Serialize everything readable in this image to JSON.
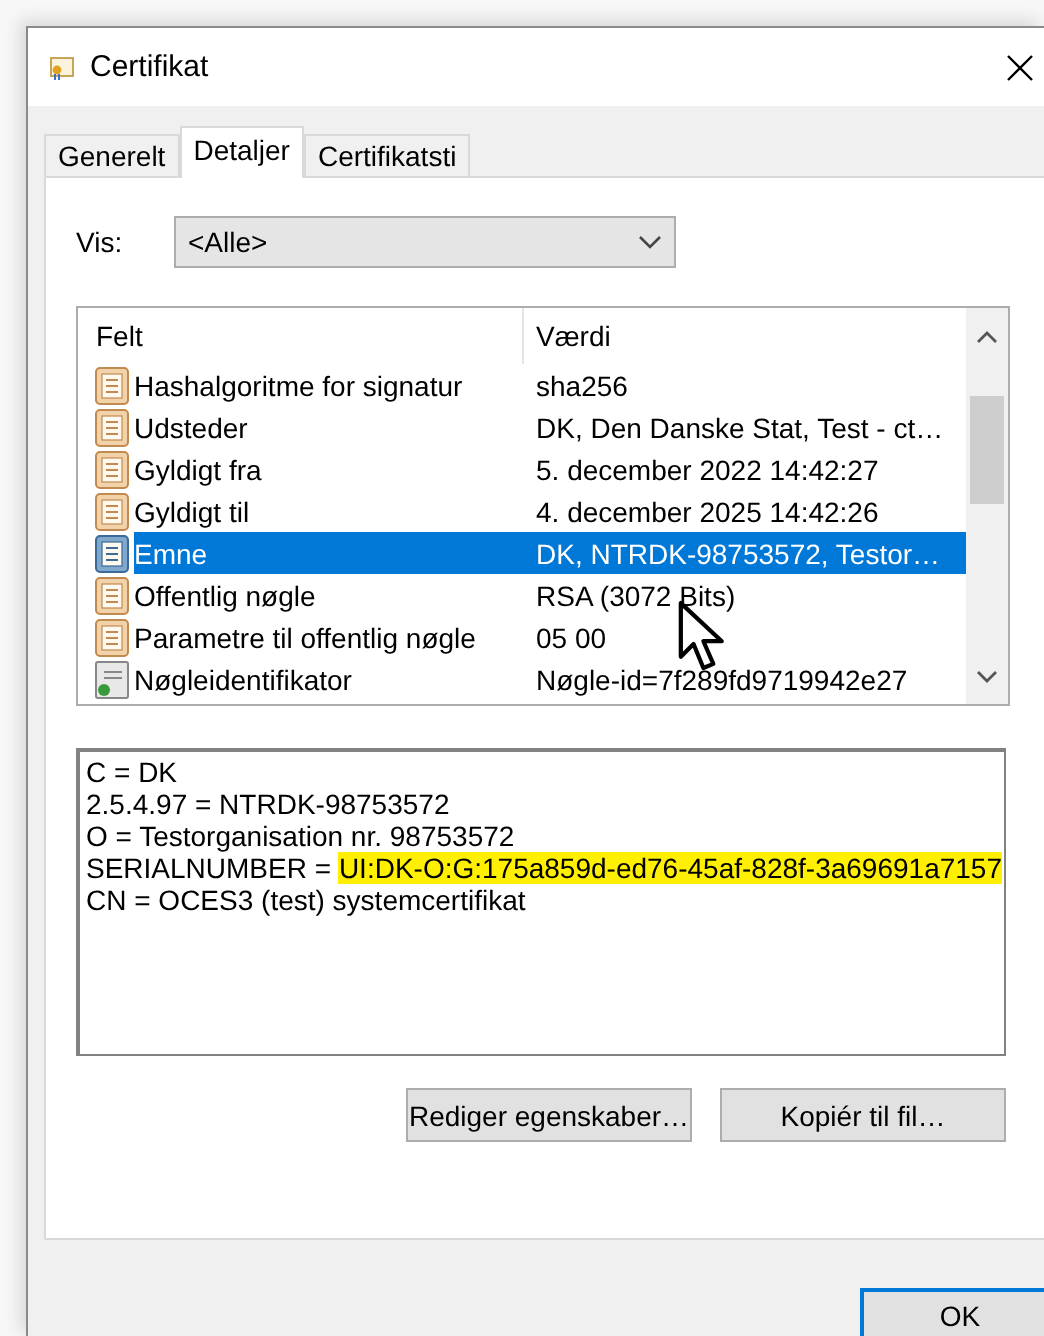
{
  "window": {
    "title": "Certifikat"
  },
  "tabs": [
    {
      "label": "Generelt",
      "selected": false
    },
    {
      "label": "Detaljer",
      "selected": true
    },
    {
      "label": "Certifikatsti",
      "selected": false
    }
  ],
  "show": {
    "label": "Vis:",
    "value": "<Alle>"
  },
  "fields_list": {
    "columns": [
      "Felt",
      "Værdi"
    ],
    "rows": [
      {
        "kind": "field",
        "field": "Hashalgoritme for signatur",
        "value": "sha256",
        "selected": false
      },
      {
        "kind": "field",
        "field": "Udsteder",
        "value": "DK, Den Danske Stat, Test - ct…",
        "selected": false
      },
      {
        "kind": "field",
        "field": "Gyldigt fra",
        "value": "5. december 2022 14:42:27",
        "selected": false
      },
      {
        "kind": "field",
        "field": "Gyldigt til",
        "value": "4. december 2025 14:42:26",
        "selected": false
      },
      {
        "kind": "field",
        "field": "Emne",
        "value": "DK, NTRDK-98753572, Testor…",
        "selected": true
      },
      {
        "kind": "field",
        "field": "Offentlig nøgle",
        "value": "RSA (3072 Bits)",
        "selected": false
      },
      {
        "kind": "field",
        "field": "Parametre til offentlig nøgle",
        "value": "05 00",
        "selected": false
      },
      {
        "kind": "extension",
        "field": "Nøgleidentifikator",
        "value": "Nøgle-id=7f289fd9719942e27",
        "selected": false
      }
    ]
  },
  "details": [
    {
      "text": "C = DK"
    },
    {
      "text": "2.5.4.97 = NTRDK-98753572"
    },
    {
      "text": "O = Testorganisation nr. 98753572"
    },
    {
      "text": "SERIALNUMBER = ",
      "highlighted_text": "UI:DK-O:G:175a859d-ed76-45af-828f-3a69691a7157"
    },
    {
      "text": "CN = OCES3 (test) systemcertifikat"
    }
  ],
  "buttons": [
    "Rediger egenskaber…",
    "Kopiér til fil…"
  ],
  "footer_buttons": [
    "OK"
  ]
}
